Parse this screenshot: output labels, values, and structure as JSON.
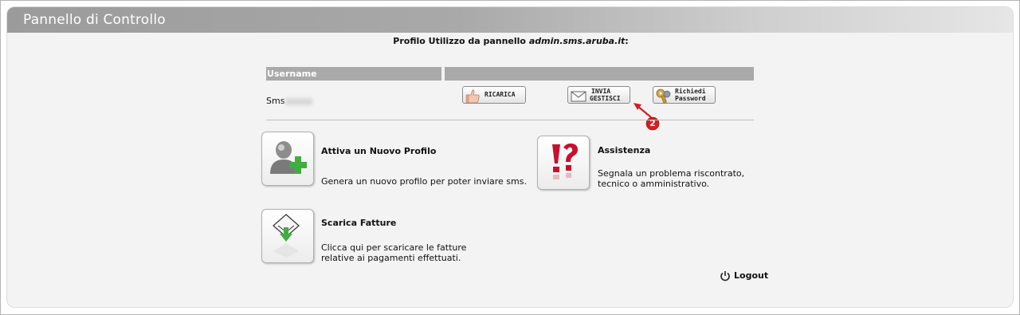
{
  "panel": {
    "title": "Pannello di Controllo"
  },
  "profile": {
    "prefix": "Profilo Utilizzo da pannello ",
    "domain": "admin.sms.aruba.it",
    "suffix": ":"
  },
  "table": {
    "header_username": "Username",
    "header_actions": "",
    "row": {
      "username": "Sms"
    },
    "buttons": {
      "ricarica": "RICARICA",
      "invia_line1": "INVIA",
      "invia_line2": "GESTISCI",
      "password_line1": "Richiedi",
      "password_line2": "Password"
    }
  },
  "annotation": {
    "badge": "2"
  },
  "features": {
    "new_profile": {
      "title": "Attiva un Nuovo Profilo",
      "desc": "Genera un nuovo profilo per poter inviare sms."
    },
    "assistance": {
      "title": "Assistenza",
      "desc_line1": "Segnala un problema riscontrato,",
      "desc_line2": "tecnico o amministrativo."
    },
    "invoices": {
      "title": "Scarica Fatture",
      "desc_line1": "Clicca qui per scaricare le fatture",
      "desc_line2": "relative ai pagamenti effettuati."
    }
  },
  "logout": {
    "label": "Logout"
  },
  "colors": {
    "header_gray": "#a9a9a9",
    "annotation_red": "#d81e1e",
    "plus_green": "#3fae3f",
    "assist_red": "#c8102e"
  }
}
